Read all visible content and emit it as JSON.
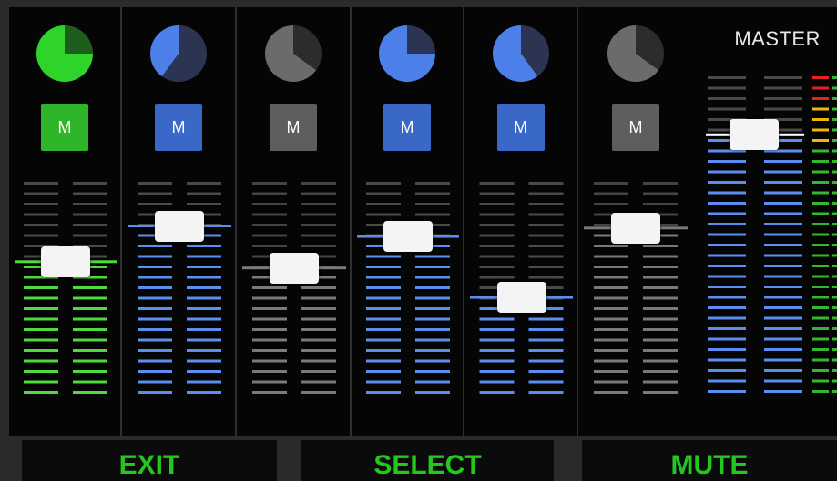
{
  "channels": [
    {
      "id": "ch1",
      "mute_label": "M",
      "knob_fraction": 0.75,
      "fader_level": 0.62,
      "colors": {
        "knob_fill": "#2fd42a",
        "knob_back": "#1d5e1c",
        "mute_bg": "#2fb52a",
        "meter": "#4ed93c",
        "inactive": "#4a4a4a"
      }
    },
    {
      "id": "ch2",
      "mute_label": "M",
      "knob_fraction": 0.4,
      "fader_level": 0.79,
      "colors": {
        "knob_fill": "#4d7fe8",
        "knob_back": "#2b3552",
        "mute_bg": "#3a68c8",
        "meter": "#5a8ef0",
        "inactive": "#4a4a4a"
      }
    },
    {
      "id": "ch3",
      "mute_label": "M",
      "knob_fraction": 0.65,
      "fader_level": 0.59,
      "colors": {
        "knob_fill": "#6b6b6b",
        "knob_back": "#2c2c2c",
        "mute_bg": "#5e5e5e",
        "meter": "#7a7a7a",
        "inactive": "#454545"
      }
    },
    {
      "id": "ch4",
      "mute_label": "M",
      "knob_fraction": 0.75,
      "fader_level": 0.74,
      "colors": {
        "knob_fill": "#4d7fe8",
        "knob_back": "#2b3552",
        "mute_bg": "#3a68c8",
        "meter": "#5a8ef0",
        "inactive": "#4a4a4a"
      }
    },
    {
      "id": "ch5",
      "mute_label": "M",
      "knob_fraction": 0.6,
      "fader_level": 0.45,
      "colors": {
        "knob_fill": "#4d7fe8",
        "knob_back": "#2b3552",
        "mute_bg": "#3a68c8",
        "meter": "#5a8ef0",
        "inactive": "#4a4a4a"
      }
    },
    {
      "id": "ch6",
      "mute_label": "M",
      "knob_fraction": 0.65,
      "fader_level": 0.78,
      "colors": {
        "knob_fill": "#6b6b6b",
        "knob_back": "#2c2c2c",
        "mute_bg": "#5e5e5e",
        "meter": "#7a7a7a",
        "inactive": "#454545"
      }
    }
  ],
  "master": {
    "label": "MASTER",
    "fader_level": 0.93,
    "colors": {
      "meter": "#5a8ef0",
      "inactive": "#4a4a4a",
      "level_green": "#32b82e",
      "level_yellow": "#f0b800",
      "level_red": "#e82020"
    }
  },
  "softkeys": [
    {
      "id": "exit",
      "label": "EXIT"
    },
    {
      "id": "select",
      "label": "SELECT"
    },
    {
      "id": "mute",
      "label": "MUTE"
    }
  ]
}
